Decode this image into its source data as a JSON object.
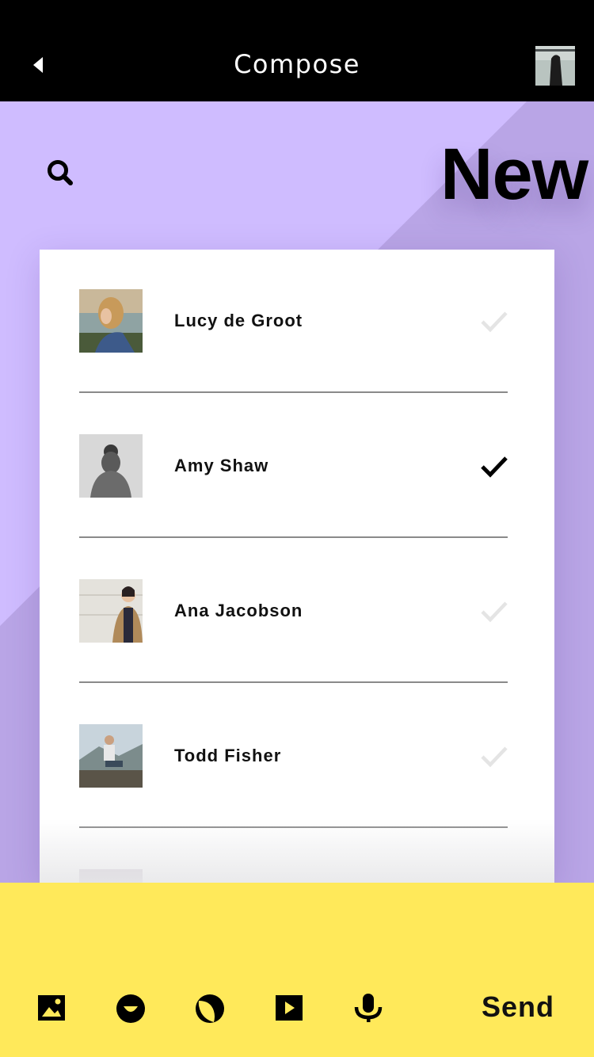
{
  "header": {
    "title": "Compose"
  },
  "hero": {
    "heading": "New"
  },
  "contacts": [
    {
      "name": "Lucy de Groot",
      "selected": false
    },
    {
      "name": "Amy Shaw",
      "selected": true
    },
    {
      "name": "Ana Jacobson",
      "selected": false
    },
    {
      "name": "Todd Fisher",
      "selected": false
    }
  ],
  "toolbar": {
    "tools": [
      "image-icon",
      "emoji-icon",
      "sticker-icon",
      "video-icon",
      "microphone-icon"
    ],
    "send_label": "Send"
  },
  "colors": {
    "header_bg": "#000000",
    "background": "#cfbcff",
    "background_shade": "#b9a5e6",
    "bottom_bar": "#ffe95a",
    "check_selected": "#000000",
    "check_unselected": "#e4e4e4"
  }
}
